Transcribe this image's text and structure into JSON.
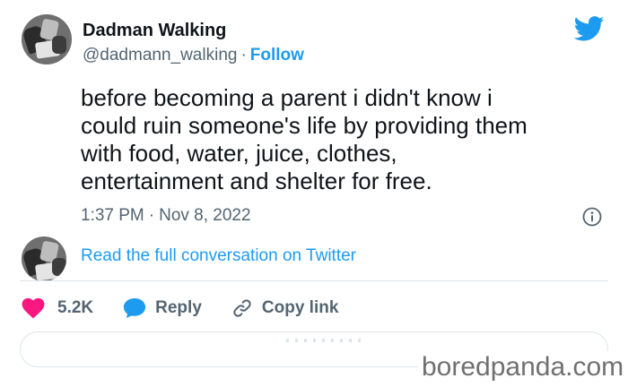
{
  "author": {
    "display_name": "Dadman Walking",
    "handle": "@dadmann_walking",
    "separator": "·",
    "follow_label": "Follow"
  },
  "tweet": {
    "lines": [
      "before becoming a parent i didn't know i",
      "could ruin someone's life by providing them",
      "with food, water, juice, clothes,",
      "entertainment and shelter for free."
    ],
    "time": "1:37 PM",
    "separator": "·",
    "date": "Nov 8, 2022"
  },
  "conversation": {
    "link_label": "Read the full conversation on Twitter"
  },
  "actions": {
    "likes": "5.2K",
    "reply_label": "Reply",
    "copy_link_label": "Copy link"
  },
  "icons": {
    "brand": "twitter-bird-icon",
    "info": "info-icon",
    "like": "heart-icon",
    "reply": "speech-bubble-icon",
    "copy": "link-icon"
  },
  "colors": {
    "twitter_blue": "#1d9bf0",
    "like_pink": "#f91880",
    "secondary_text": "#536471",
    "primary_text": "#0f1419"
  },
  "watermark": "boredpanda.com"
}
